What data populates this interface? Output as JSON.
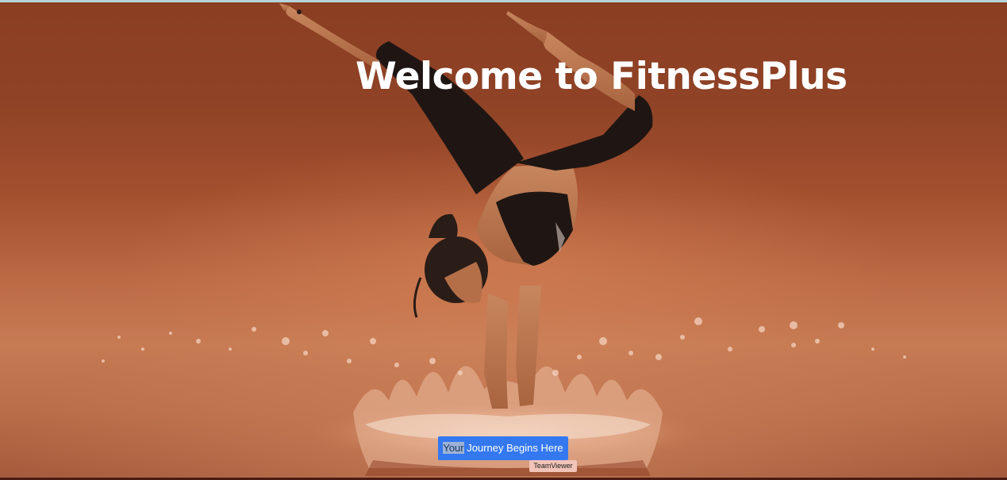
{
  "hero": {
    "title": "Welcome to FitnessPlus",
    "image": "handstand-woman-water-splash"
  },
  "cta": {
    "label_highlighted": "Your",
    "label_rest": " Journey Begins Here"
  },
  "tooltip": {
    "text": "TeamViewer"
  },
  "colors": {
    "button": "#3478f0",
    "title": "#ffffff",
    "background": "#a24f2e",
    "tooltip": "#f2c4b8"
  }
}
